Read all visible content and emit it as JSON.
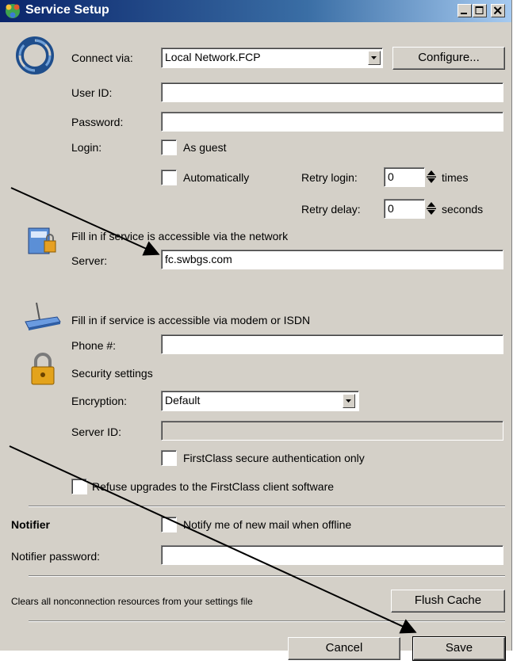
{
  "window": {
    "title": "Service Setup",
    "title_icon": "globe-people-icon",
    "controls": [
      "minimize-icon",
      "maximize-icon",
      "close-icon"
    ]
  },
  "connection": {
    "connect_via_label": "Connect via:",
    "connect_via_value": "Local Network.FCP",
    "configure_button": "Configure...",
    "user_id_label": "User ID:",
    "user_id_value": "",
    "password_label": "Password:",
    "password_value": "",
    "login_label": "Login:",
    "as_guest_label": "As guest",
    "automatically_label": "Automatically",
    "retry_login_label": "Retry login:",
    "retry_login_value": "0",
    "retry_login_unit": "times",
    "retry_delay_label": "Retry delay:",
    "retry_delay_value": "0",
    "retry_delay_unit": "seconds"
  },
  "network": {
    "hint": "Fill in if service is accessible via the network",
    "server_label": "Server:",
    "server_value": "fc.swbgs.com"
  },
  "modem": {
    "hint": "Fill in if service is accessible via modem or ISDN",
    "phone_label": "Phone #:",
    "phone_value": ""
  },
  "security": {
    "title": "Security settings",
    "encryption_label": "Encryption:",
    "encryption_value": "Default",
    "server_id_label": "Server ID:",
    "server_id_value": "",
    "secure_auth_label": "FirstClass secure authentication only",
    "refuse_upgrades_label": "Refuse upgrades to the FirstClass client software"
  },
  "notifier": {
    "title": "Notifier",
    "notify_label": "Notify me of new mail when offline",
    "password_label": "Notifier password:",
    "password_value": ""
  },
  "cache": {
    "text": "Clears all nonconnection resources from your settings file",
    "flush_button": "Flush Cache"
  },
  "footer": {
    "cancel_button": "Cancel",
    "save_button": "Save"
  },
  "colors": {
    "window_bg": "#d4d0c8",
    "titlebar": "#0a246a",
    "arrow": "#000000"
  }
}
